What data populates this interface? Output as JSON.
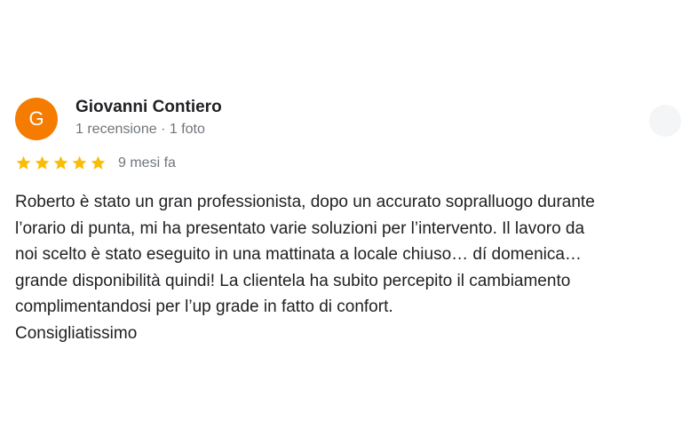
{
  "review": {
    "avatar_letter": "G",
    "avatar_color": "#f57c00",
    "author_name": "Giovanni Contiero",
    "author_meta": "1 recensione · 1 foto",
    "rating": 5,
    "star_color": "#fbbc04",
    "date": "9 mesi fa",
    "text_lines": [
      "Roberto è stato un gran professionista, dopo un accurato sopralluogo durante",
      "l’orario di punta, mi ha presentato varie soluzioni per l’intervento. Il lavoro da",
      "noi scelto è stato eseguito in una mattinata a locale chiuso… dí domenica…",
      "grande disponibilità quindi! La clientela ha subito percepito il cambiamento",
      "complimentandosi per l’up grade in fatto di confort.",
      "Consigliatissimo"
    ]
  }
}
